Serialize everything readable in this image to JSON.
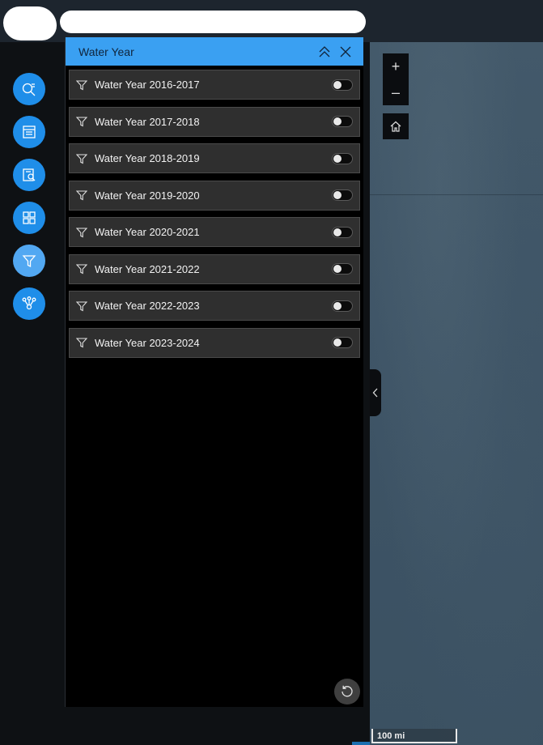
{
  "panel": {
    "title": "Water Year",
    "filters": [
      {
        "label": "Water Year 2016-2017",
        "enabled": false
      },
      {
        "label": "Water Year 2017-2018",
        "enabled": false
      },
      {
        "label": "Water Year 2018-2019",
        "enabled": false
      },
      {
        "label": "Water Year 2019-2020",
        "enabled": false
      },
      {
        "label": "Water Year 2020-2021",
        "enabled": false
      },
      {
        "label": "Water Year 2021-2022",
        "enabled": false
      },
      {
        "label": "Water Year 2022-2023",
        "enabled": false
      },
      {
        "label": "Water Year 2023-2024",
        "enabled": false
      }
    ]
  },
  "map": {
    "zoom_in": "+",
    "zoom_out": "–",
    "scale_label": "100 mi"
  },
  "rail": {
    "items": [
      "search-icon",
      "table-icon",
      "query-icon",
      "grid-icon",
      "filter-icon",
      "share-icon"
    ],
    "active": "filter-icon"
  },
  "colors": {
    "accent": "#1f8ee9",
    "header": "#3aa0f2",
    "map": "#3f5567"
  }
}
